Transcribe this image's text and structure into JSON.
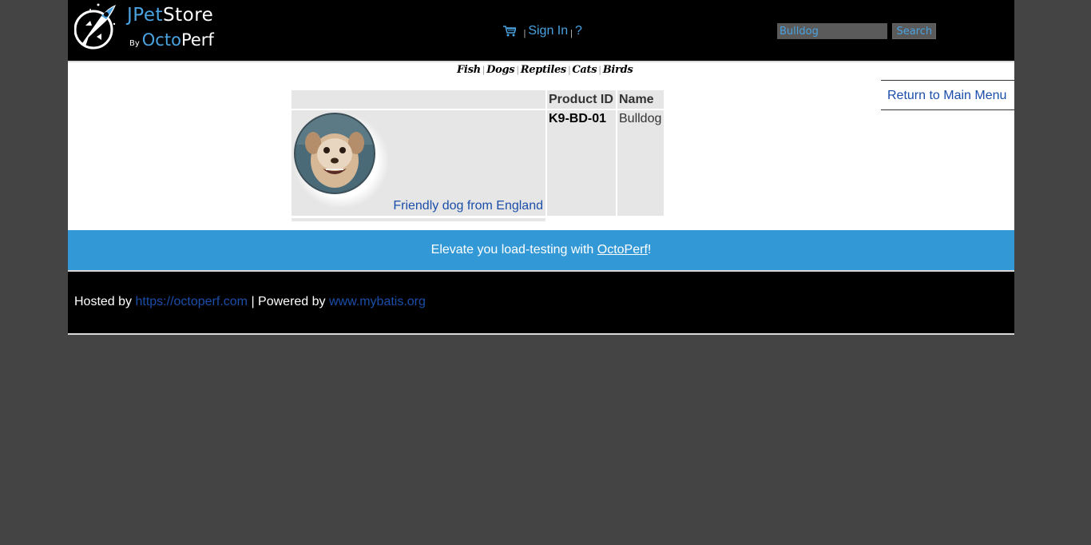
{
  "header": {
    "logo": {
      "jpet": "JPet",
      "store": "Store",
      "by": "By",
      "octo": "Octo",
      "perf": "Perf"
    },
    "nav": {
      "sign_in": "Sign In",
      "help": "?",
      "separator": "|"
    },
    "search": {
      "value": "Bulldog",
      "button": "Search"
    }
  },
  "quicklinks": [
    "Fish",
    "Dogs",
    "Reptiles",
    "Cats",
    "Birds"
  ],
  "sidebar": {
    "return_label": "Return to Main Menu"
  },
  "table": {
    "headers": {
      "image": "",
      "product_id": "Product ID",
      "name": "Name"
    },
    "rows": [
      {
        "description": "Friendly dog from England",
        "product_id": "K9-BD-01",
        "name": "Bulldog"
      }
    ]
  },
  "banner": {
    "prefix": "Elevate you load-testing with ",
    "link": "OctoPerf",
    "suffix": "!"
  },
  "footer": {
    "hosted_label": "Hosted by ",
    "hosted_link": "https://octoperf.com",
    "powered_label": " | Powered by ",
    "powered_link": "www.mybatis.org"
  },
  "colors": {
    "accent": "#4aa3e0",
    "link": "#1a4ea8",
    "banner": "#3399d6",
    "background": "#444444"
  }
}
